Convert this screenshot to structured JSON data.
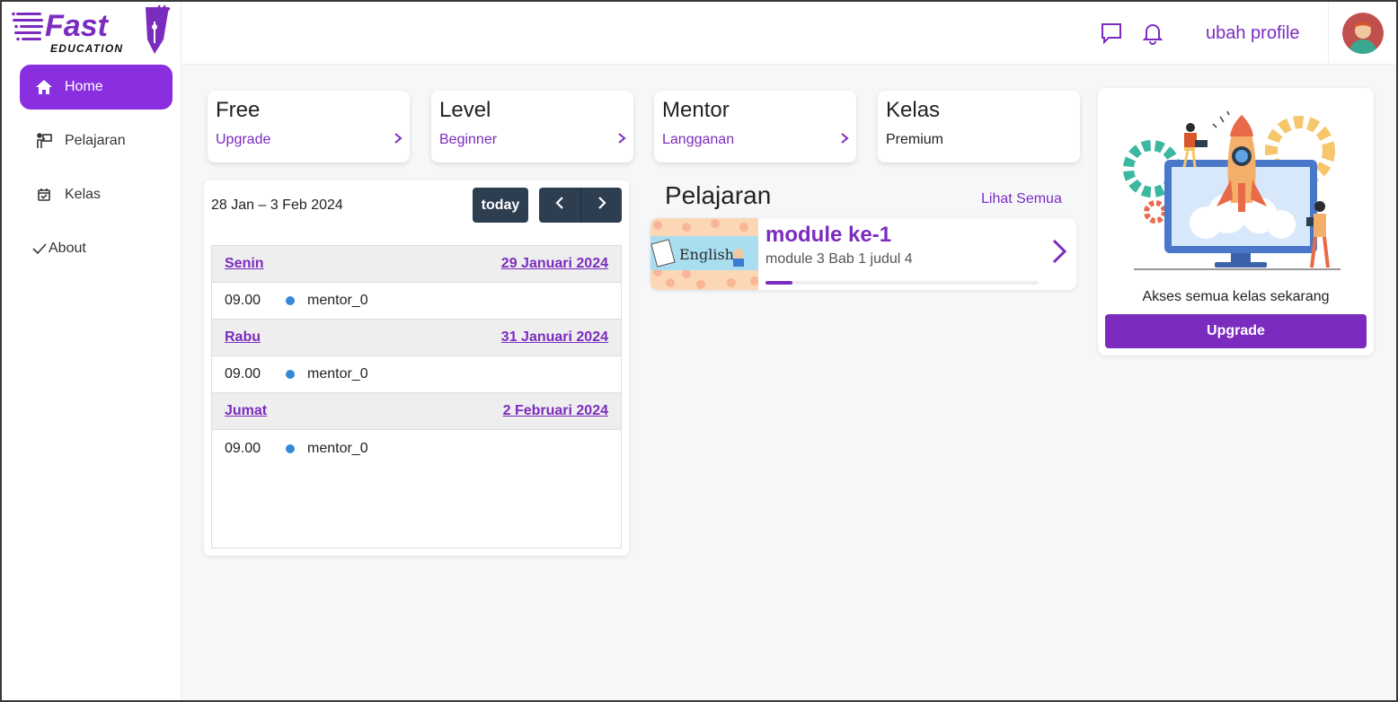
{
  "brand": {
    "name": "Fast",
    "tagline": "EDUCATION"
  },
  "sidebar": {
    "items": [
      {
        "label": "Home",
        "icon": "home-icon",
        "active": true
      },
      {
        "label": "Pelajaran",
        "icon": "teacher-board-icon"
      },
      {
        "label": "Kelas",
        "icon": "calendar-check-icon"
      },
      {
        "label": "About",
        "icon": "check-icon"
      }
    ]
  },
  "header": {
    "profile_link": "ubah profile",
    "icons": [
      "chat-icon",
      "bell-icon"
    ]
  },
  "stats": [
    {
      "title": "Free",
      "sub": "Upgrade",
      "link": true
    },
    {
      "title": "Level",
      "sub": "Beginner",
      "link": true
    },
    {
      "title": "Mentor",
      "sub": "Langganan",
      "link": true
    },
    {
      "title": "Kelas",
      "sub": "Premium",
      "link": false
    }
  ],
  "calendar": {
    "range": "28 Jan – 3 Feb 2024",
    "today_label": "today",
    "days": [
      {
        "day": "Senin",
        "date": "29 Januari 2024",
        "time": "09.00",
        "event": "mentor_0"
      },
      {
        "day": "Rabu",
        "date": "31 Januari 2024",
        "time": "09.00",
        "event": "mentor_0"
      },
      {
        "day": "Jumat",
        "date": "2 Februari 2024",
        "time": "09.00",
        "event": "mentor_0"
      }
    ]
  },
  "pelajaran": {
    "title": "Pelajaran",
    "see_all": "Lihat Semua",
    "module": {
      "title": "module ke-1",
      "subtitle": "module 3 Bab 1 judul 4",
      "thumb_text": "English",
      "progress": 0.1
    }
  },
  "upgrade_card": {
    "message": "Akses semua kelas sekarang",
    "button": "Upgrade"
  },
  "colors": {
    "accent": "#7b2cbf",
    "dark": "#2c3e50",
    "event_dot": "#3788d8"
  }
}
